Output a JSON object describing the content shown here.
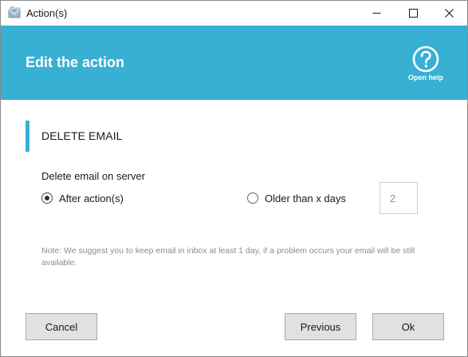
{
  "window": {
    "title": "Action(s)",
    "controls": {
      "minimize": "—",
      "maximize": "☐",
      "close": "✕"
    }
  },
  "header": {
    "title": "Edit the action",
    "help_label": "Open help",
    "background": "#37b0d4"
  },
  "section": {
    "title": "DELETE EMAIL",
    "field_label": "Delete email on server",
    "options": [
      {
        "label": "After action(s)",
        "selected": true
      },
      {
        "label": "Older than x days",
        "selected": false
      }
    ],
    "days_value": "2",
    "note": "Note: We suggest you to keep email in inbox at least 1 day, if a problem occurs your email will be still available."
  },
  "footer": {
    "cancel_label": "Cancel",
    "previous_label": "Previous",
    "ok_label": "Ok"
  }
}
